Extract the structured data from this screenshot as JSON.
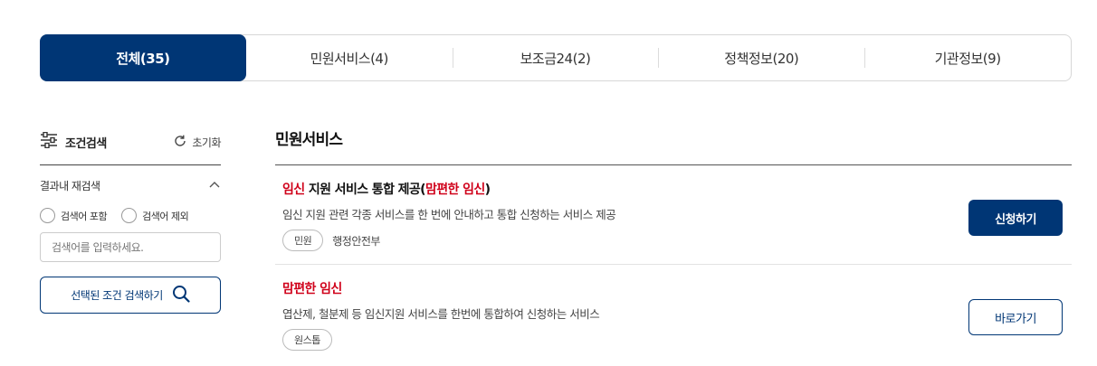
{
  "tabs": [
    {
      "label": "전체(35)",
      "active": true
    },
    {
      "label": "민원서비스(4)",
      "active": false
    },
    {
      "label": "보조금24(2)",
      "active": false
    },
    {
      "label": "정책정보(20)",
      "active": false
    },
    {
      "label": "기관정보(9)",
      "active": false
    }
  ],
  "sidebar": {
    "title": "조건검색",
    "reset_label": "초기화",
    "subsection_title": "결과내 재검색",
    "radio_include": "검색어 포함",
    "radio_exclude": "검색어 제외",
    "search_placeholder": "검색어를 입력하세요.",
    "search_button_label": "선택된 조건 검색하기"
  },
  "main": {
    "section_title": "민원서비스",
    "items": [
      {
        "title_highlight": "임신",
        "title_rest": " 지원 서비스 통합 제공(",
        "title_highlight2": "맘편한 임신",
        "title_end": ")",
        "description": "임신 지원 관련 각종 서비스를 한 번에 안내하고 통합 신청하는 서비스 제공",
        "badge": "민원",
        "org": "행정안전부",
        "button_label": "신청하기"
      },
      {
        "title_highlight": "맘편한 임신",
        "description": "엽산제, 철분제 등 임신지원 서비스를 한번에 통합하여 신청하는 서비스",
        "badge": "원스톱",
        "button_label": "바로가기"
      }
    ]
  },
  "colors": {
    "primary": "#003675",
    "highlight": "#d0021b"
  }
}
